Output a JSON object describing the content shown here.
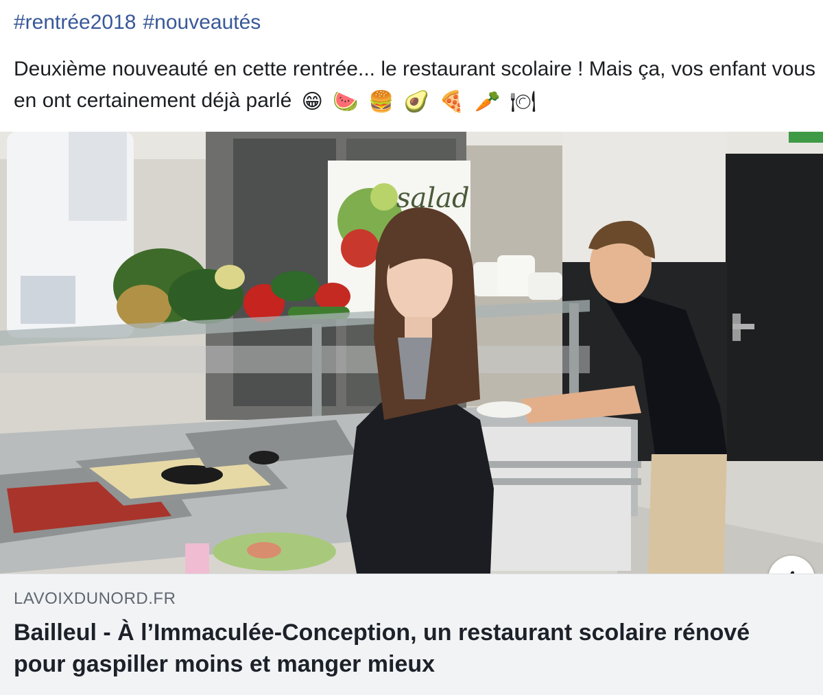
{
  "post": {
    "hashtags": [
      "#rentrée2018",
      "#nouveautés"
    ],
    "text": "Deuxième nouveauté en cette rentrée... le restaurant scolaire ! Mais ça, vos enfant vous en ont certainement déjà parlé",
    "emojis": [
      "😁",
      "🍉",
      "🍔",
      "🥑",
      "🍕",
      "🥕",
      "🍽"
    ]
  },
  "link_preview": {
    "image_alt": "Two students at a school cafeteria serving counter",
    "sign_text": "salad",
    "domain": "LAVOIXDUNORD.FR",
    "headline": "Bailleul - À l’Immaculée-Conception, un restaurant scolaire rénové pour gaspiller moins et manger mieux",
    "info_label": "i"
  }
}
